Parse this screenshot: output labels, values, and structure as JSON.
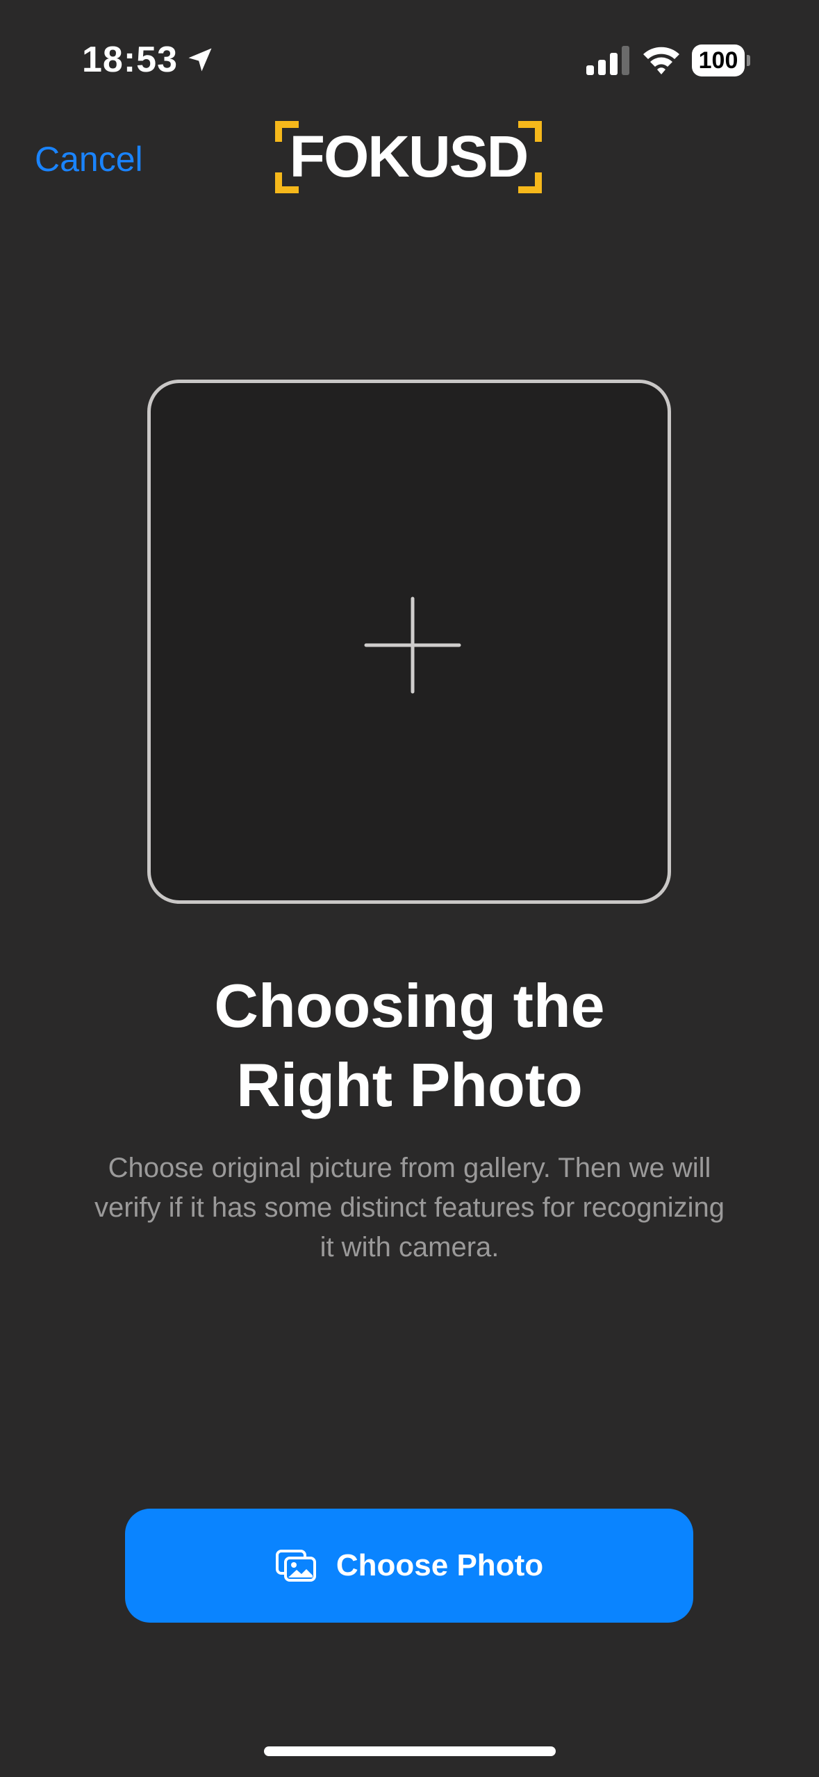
{
  "status_bar": {
    "time": "18:53",
    "battery": "100"
  },
  "nav": {
    "cancel_label": "Cancel",
    "logo_text": "FOKUSD"
  },
  "main": {
    "title_line1": "Choosing the",
    "title_line2": "Right Photo",
    "description": "Choose original picture from gallery. Then we will verify if it has some distinct features for recognizing it with camera.",
    "choose_button_label": "Choose Photo"
  },
  "icons": {
    "location": "location-arrow-icon",
    "signal": "cellular-signal-icon",
    "wifi": "wifi-icon",
    "plus": "plus-icon",
    "photos": "photos-icon"
  },
  "colors": {
    "background": "#2a2929",
    "accent": "#0a84ff",
    "link": "#1a84ff",
    "logo_bracket": "#f6b81b"
  }
}
